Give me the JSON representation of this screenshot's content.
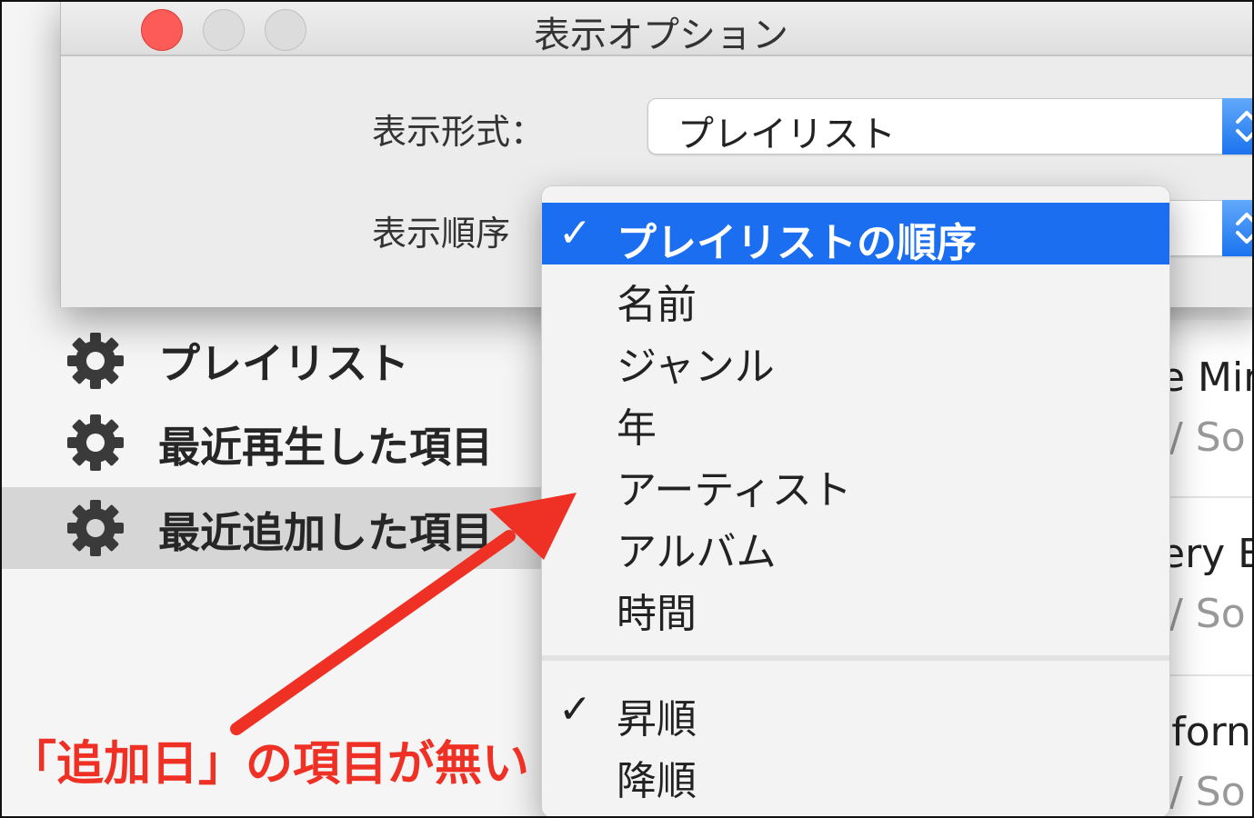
{
  "dialog": {
    "title": "表示オプション",
    "view_format_label": "表示形式：",
    "view_format_value": "プレイリスト",
    "sort_order_label": "表示順序"
  },
  "sidebar": {
    "items": [
      {
        "label": "プレイリスト"
      },
      {
        "label": "最近再生した項目"
      },
      {
        "label": "最近追加した項目"
      }
    ]
  },
  "right_column": {
    "texts": [
      "e Mira",
      "/ So",
      "ery B",
      "/ So",
      "iforn",
      "/ So"
    ]
  },
  "menu": {
    "sort_items": [
      {
        "label": "プレイリストの順序",
        "checked": true
      },
      {
        "label": "名前",
        "checked": false
      },
      {
        "label": "ジャンル",
        "checked": false
      },
      {
        "label": "年",
        "checked": false
      },
      {
        "label": "アーティスト",
        "checked": false
      },
      {
        "label": "アルバム",
        "checked": false
      },
      {
        "label": "時間",
        "checked": false
      }
    ],
    "direction_items": [
      {
        "label": "昇順",
        "checked": true
      },
      {
        "label": "降順",
        "checked": false
      }
    ],
    "check_glyph": "✓"
  },
  "annotation": {
    "text": "「追加日」の項目が無い",
    "color": "#ee3124"
  },
  "colors": {
    "highlight": "#1c6ef1",
    "close_button": "#fc5b57"
  },
  "icons": {
    "sidebar": "gear-icon",
    "popup": "up-down-chevrons-icon"
  }
}
